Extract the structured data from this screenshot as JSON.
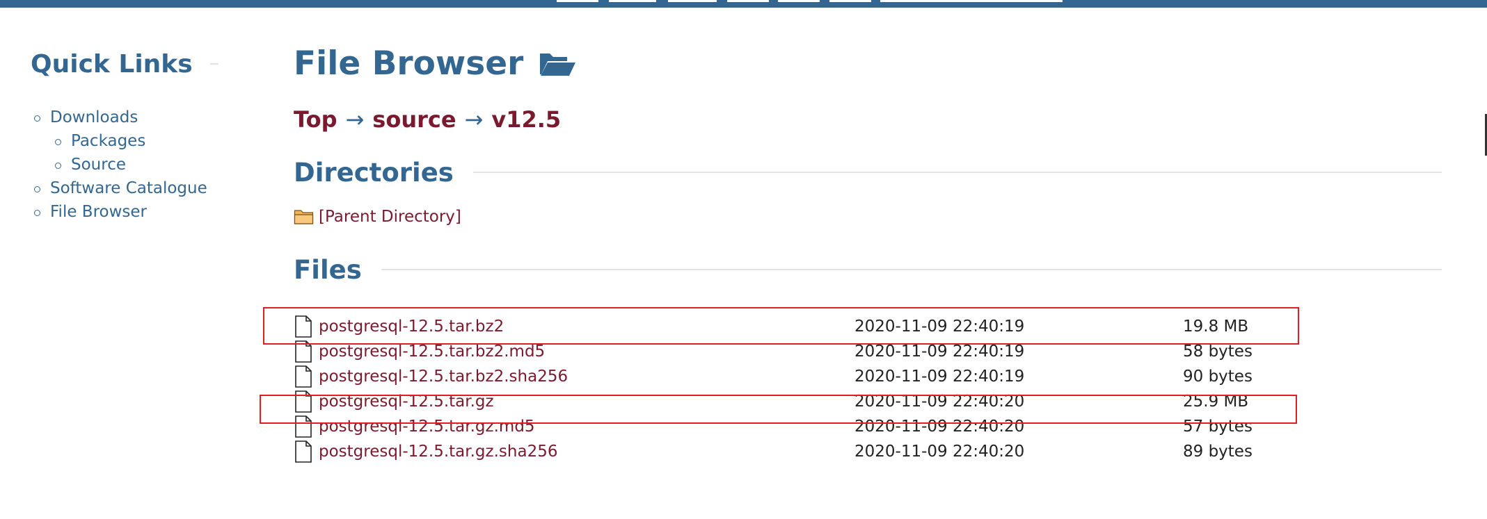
{
  "sidebar": {
    "title": "Quick Links",
    "items": [
      {
        "label": "Downloads",
        "children": [
          {
            "label": "Packages"
          },
          {
            "label": "Source"
          }
        ]
      },
      {
        "label": "Software Catalogue"
      },
      {
        "label": "File Browser"
      }
    ]
  },
  "main": {
    "title": "File Browser",
    "title_icon": "folder-open-icon",
    "breadcrumb": {
      "items": [
        "Top",
        "source",
        "v12.5"
      ],
      "separator": "→"
    },
    "directories": {
      "heading": "Directories",
      "parent_label": "[Parent Directory]",
      "icon": "folder-icon"
    },
    "files": {
      "heading": "Files",
      "rows": [
        {
          "name": "postgresql-12.5.tar.bz2",
          "date": "2020-11-09 22:40:19",
          "size": "19.8 MB",
          "highlighted": true
        },
        {
          "name": "postgresql-12.5.tar.bz2.md5",
          "date": "2020-11-09 22:40:19",
          "size": "58 bytes",
          "highlighted": false
        },
        {
          "name": "postgresql-12.5.tar.bz2.sha256",
          "date": "2020-11-09 22:40:19",
          "size": "90 bytes",
          "highlighted": false
        },
        {
          "name": "postgresql-12.5.tar.gz",
          "date": "2020-11-09 22:40:20",
          "size": "25.9 MB",
          "highlighted": true
        },
        {
          "name": "postgresql-12.5.tar.gz.md5",
          "date": "2020-11-09 22:40:20",
          "size": "57 bytes",
          "highlighted": false
        },
        {
          "name": "postgresql-12.5.tar.gz.sha256",
          "date": "2020-11-09 22:40:20",
          "size": "89 bytes",
          "highlighted": false
        }
      ]
    }
  },
  "colors": {
    "brand_blue": "#336791",
    "link_maroon": "#7b1a2f",
    "highlight_red": "#e31b23"
  }
}
